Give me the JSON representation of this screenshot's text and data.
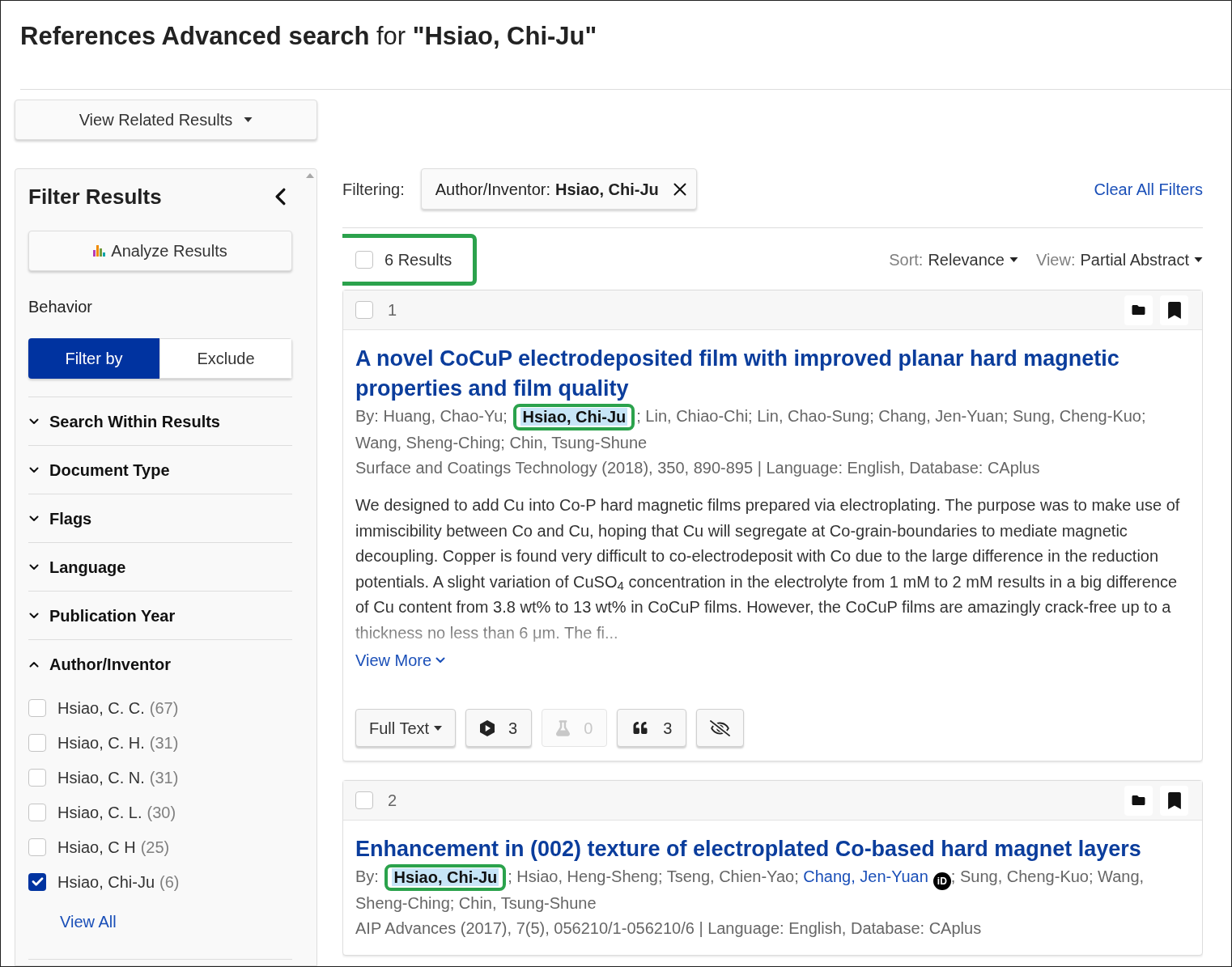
{
  "page": {
    "title": "**References Advanced search** for **\"Hsiao, Chi-Ju\"**"
  },
  "sidebar": {
    "related_button": "View Related Results",
    "filter_panel": {
      "title": "Filter Results",
      "analyze_button": "Analyze Results",
      "behavior_label": "Behavior",
      "behavior_options": [
        {
          "label": "Filter by",
          "selected": true
        },
        {
          "label": "Exclude",
          "selected": false
        }
      ],
      "sections": [
        {
          "label": "Search Within Results",
          "expanded": false
        },
        {
          "label": "Document Type",
          "expanded": false
        },
        {
          "label": "Flags",
          "expanded": false
        },
        {
          "label": "Language",
          "expanded": false
        },
        {
          "label": "Publication Year",
          "expanded": false
        },
        {
          "label": "Author/Inventor",
          "expanded": true,
          "options": [
            {
              "name": "Hsiao, C. C.",
              "count": "(67)",
              "checked": false
            },
            {
              "name": "Hsiao, C. H.",
              "count": "(31)",
              "checked": false
            },
            {
              "name": "Hsiao, C. N.",
              "count": "(31)",
              "checked": false
            },
            {
              "name": "Hsiao, C. L.",
              "count": "(30)",
              "checked": false
            },
            {
              "name": "Hsiao, C H",
              "count": "(25)",
              "checked": false
            },
            {
              "name": "Hsiao, Chi-Ju",
              "count": "(6)",
              "checked": true
            }
          ],
          "view_all": "View All"
        }
      ]
    }
  },
  "filter_bar": {
    "label": "Filtering:",
    "chips": [
      {
        "field": "Author/Inventor:",
        "value": "Hsiao, Chi-Ju"
      }
    ],
    "clear_all": "Clear All Filters"
  },
  "results_bar": {
    "count": "6 Results",
    "checked": false,
    "callout": true,
    "sort": {
      "label": "Sort:",
      "value": "Relevance"
    },
    "view": {
      "label": "View:",
      "value": "Partial Abstract"
    }
  },
  "results": [
    {
      "number": "1",
      "checked": false,
      "title": "A novel CoCuP electrodeposited film with improved planar hard magnetic properties and film quality",
      "authors": [
        {
          "kind": "plain",
          "text": "By: Huang, Chao-Yu; "
        },
        {
          "kind": "highlight",
          "text": "Hsiao, Chi-Ju",
          "callout": true
        },
        {
          "kind": "plain",
          "text": "; Lin, Chiao-Chi; Lin, Chao-Sung; Chang, Jen-Yuan; Sung, Cheng-Kuo; Wang, Sheng-Ching; Chin, Tsung-Shune"
        }
      ],
      "source": "Surface and Coatings Technology (2018), 350, 890-895 | Language: English, Database: CAplus",
      "abstract": "We designed to add Cu into Co-P hard magnetic films prepared via electroplating. The purpose was to make use of immiscibility between Co and Cu, hoping that Cu will segregate at Co-grain-boundaries to mediate magnetic decoupling. Copper is found very difficult to co-electrodeposit with Co due to the large difference in the reduction potentials. A slight variation of CuSO$_{4}$ concentration in the electrolyte from 1 mM to 2 mM results in a big difference of Cu content from 3.8 wt% to 13 wt% in CoCuP films. However, the CoCuP films are amazingly crack-free up to a thickness no less than 6 μm. The fi...",
      "view_more": "View More",
      "actions": [
        {
          "kind": "menu",
          "label": "Full Text"
        },
        {
          "kind": "substances",
          "count": "3",
          "disabled": false
        },
        {
          "kind": "reactions",
          "count": "0",
          "disabled": true
        },
        {
          "kind": "citations",
          "count": "3",
          "disabled": false
        },
        {
          "kind": "hide"
        }
      ]
    },
    {
      "number": "2",
      "checked": false,
      "title": "Enhancement in (002) texture of electroplated Co-based hard magnet layers",
      "authors": [
        {
          "kind": "plain",
          "text": "By: "
        },
        {
          "kind": "highlight",
          "text": "Hsiao, Chi-Ju",
          "callout": true
        },
        {
          "kind": "plain",
          "text": "; Hsiao, Heng-Sheng; Tseng, Chien-Yao; "
        },
        {
          "kind": "link",
          "text": "Chang, Jen-Yuan",
          "badge": "iD"
        },
        {
          "kind": "plain",
          "text": "; Sung, Cheng-Kuo; Wang, Sheng-Ching; Chin, Tsung-Shune"
        }
      ],
      "source": "AIP Advances (2017), 7(5), 056210/1-056210/6 | Language: English, Database: CAplus"
    }
  ]
}
